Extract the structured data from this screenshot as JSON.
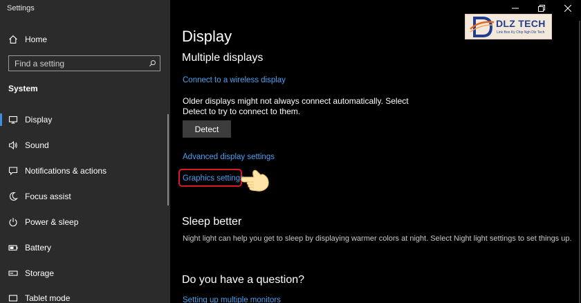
{
  "window": {
    "title": "Settings"
  },
  "sidebar": {
    "home_label": "Home",
    "search_placeholder": "Find a setting",
    "section_label": "System",
    "items": [
      {
        "label": "Display",
        "icon": "monitor-icon",
        "selected": true
      },
      {
        "label": "Sound",
        "icon": "speaker-icon"
      },
      {
        "label": "Notifications & actions",
        "icon": "notification-icon"
      },
      {
        "label": "Focus assist",
        "icon": "moon-icon"
      },
      {
        "label": "Power & sleep",
        "icon": "power-icon"
      },
      {
        "label": "Battery",
        "icon": "battery-icon"
      },
      {
        "label": "Storage",
        "icon": "storage-icon"
      },
      {
        "label": "Tablet mode",
        "icon": "tablet-icon"
      }
    ]
  },
  "main": {
    "title": "Display",
    "multiple_displays": {
      "heading": "Multiple displays",
      "wireless_link": "Connect to a wireless display",
      "description": "Older displays might not always connect automatically. Select Detect to try to connect to them.",
      "detect_button": "Detect",
      "advanced_link": "Advanced display settings",
      "graphics_link": "Graphics settings"
    },
    "sleep_better": {
      "heading": "Sleep better",
      "description": "Night light can help you get to sleep by displaying warmer colors at night. Select Night light settings to set things up."
    },
    "question": {
      "heading": "Do you have a question?",
      "link": "Setting up multiple monitors"
    }
  },
  "watermark": {
    "brand": "DLZ TECH",
    "tagline": "Link Boo Ky Chip Ngh Dlz Tech"
  },
  "colors": {
    "accent_link": "#4ca0ee",
    "highlight": "#d91a25",
    "sidebar_bg": "#2b2b2b",
    "main_bg": "#000000",
    "brand": "#223d8e"
  }
}
